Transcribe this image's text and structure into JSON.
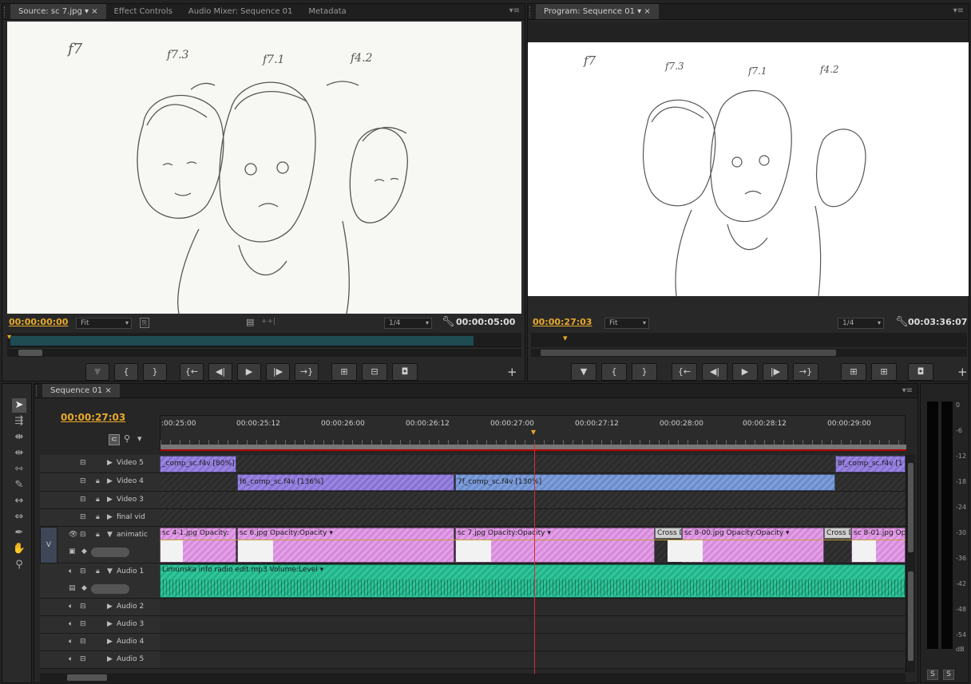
{
  "source": {
    "tabs": [
      "Source: sc 7.jpg",
      "Effect Controls",
      "Audio Mixer: Sequence 01",
      "Metadata"
    ],
    "timecode_in": "00:00:00:00",
    "fit": "Fit",
    "quality": "1/4",
    "duration": "00:00:05:00",
    "sketch_labels": [
      "f7",
      "f7.3",
      "f7.1",
      "f4.2"
    ]
  },
  "program": {
    "tabs": [
      "Program: Sequence 01"
    ],
    "timecode": "00:00:27:03",
    "fit": "Fit",
    "quality": "1/4",
    "duration": "00:03:36:07",
    "sketch_labels": [
      "f7",
      "f7.3",
      "f7.1",
      "f4.2"
    ]
  },
  "timeline": {
    "tab": "Sequence 01",
    "timecode": "00:00:27:03",
    "ruler": [
      ":00:25:00",
      "00:00:25:12",
      "00:00:26:00",
      "00:00:26:12",
      "00:00:27:00",
      "00:00:27:12",
      "00:00:28:00",
      "00:00:28:12",
      "00:00:29:00"
    ],
    "tracks": {
      "video5": "Video 5",
      "video4": "Video 4",
      "video3": "Video 3",
      "finalvid": "final vid",
      "animatic": "animatic",
      "audio1": "Audio 1",
      "audio2": "Audio 2",
      "audio3": "Audio 3",
      "audio4": "Audio 4",
      "audio5": "Audio 5",
      "v_label": "V"
    },
    "clips": {
      "v5a": "_comp_sc.f4v [80%]",
      "v5b": "8f_comp_sc.f4v [1",
      "v4a": "f6_comp_sc.f4v [136%]",
      "v4b": "7f_comp_sc.f4v [130%]",
      "an1": "sc 4-1.jpg  Opacity:",
      "an2": "sc 6.jpg  Opacity:Opacity ▾",
      "an3": "sc 7.jpg  Opacity:Opacity ▾",
      "an4": "Cross D",
      "an5": "sc 8-00.jpg  Opacity:Opacity ▾",
      "an6": "Cross D",
      "an7": "sc 8-01.jpg  Op",
      "au1": "Limunska info radio edit.mp3  Volume:Level ▾"
    },
    "playhead_fraction": 0.503
  },
  "meter": {
    "scale": [
      "0",
      "-6",
      "-12",
      "-18",
      "-24",
      "-30",
      "-36",
      "-42",
      "-48",
      "-54",
      "dB"
    ],
    "solo": [
      "S",
      "S"
    ]
  }
}
